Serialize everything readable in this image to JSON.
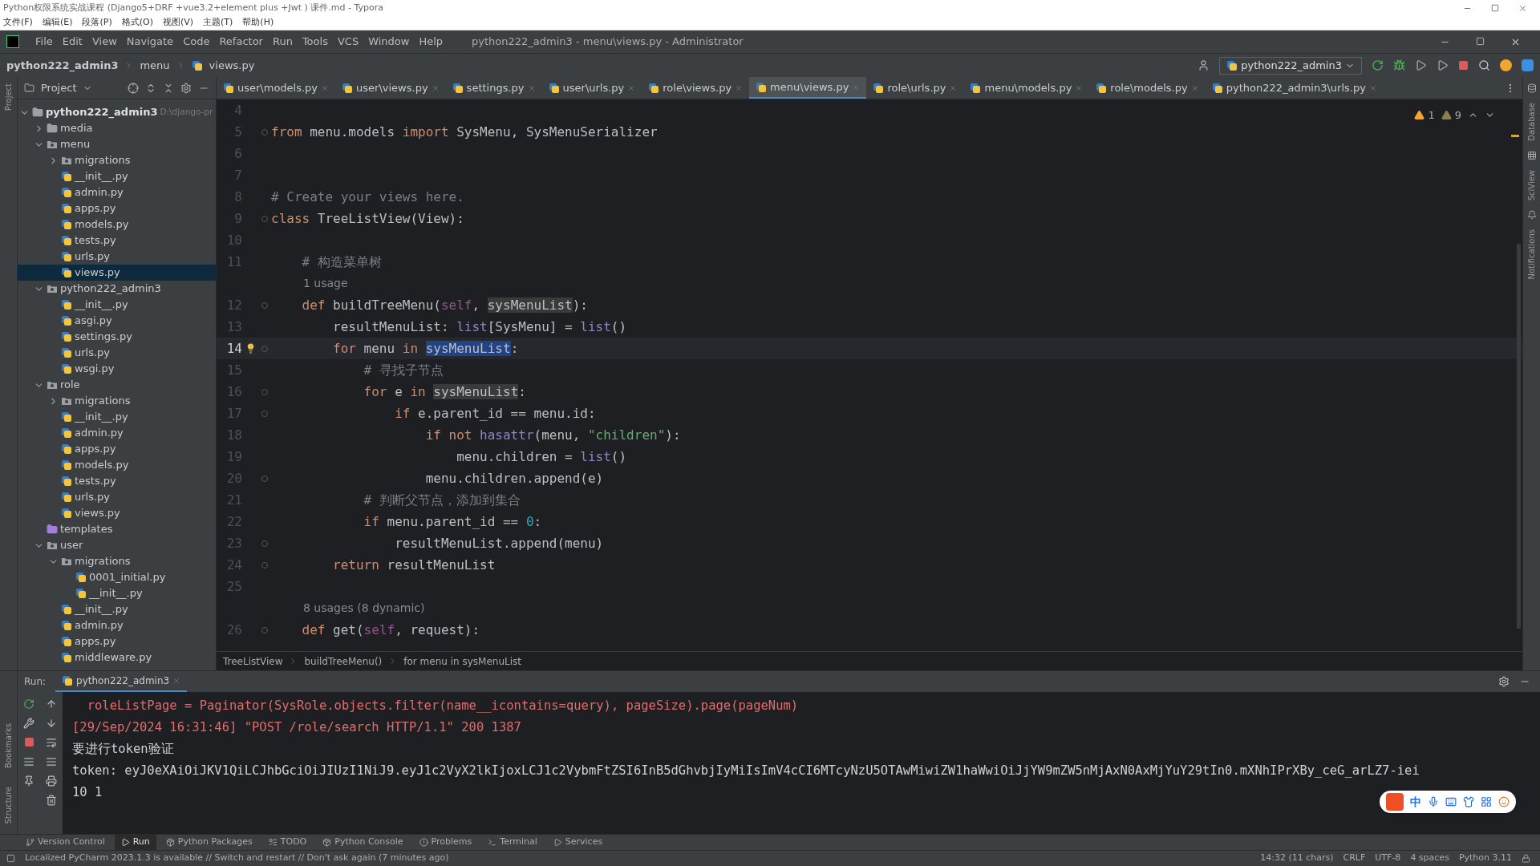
{
  "typora": {
    "title": "Python权限系统实战课程 (Django5+DRF +vue3.2+element plus +Jwt ) 课件.md - Typora",
    "menu": [
      "文件(F)",
      "编辑(E)",
      "段落(P)",
      "格式(O)",
      "视图(V)",
      "主题(T)",
      "帮助(H)"
    ]
  },
  "menu_bar": {
    "items": [
      "File",
      "Edit",
      "View",
      "Navigate",
      "Code",
      "Refactor",
      "Run",
      "Tools",
      "VCS",
      "Window",
      "Help"
    ],
    "title": "python222_admin3 - menu\\views.py - Administrator"
  },
  "nav_bar": {
    "breadcrumb": [
      "python222_admin3",
      "menu",
      "views.py"
    ],
    "run_config": "python222_admin3"
  },
  "left_strip": [
    "Project",
    "Bookmarks",
    "Structure"
  ],
  "right_strip": [
    "Database",
    "SciView",
    "Notifications"
  ],
  "project_panel": {
    "title": "Project",
    "tree": [
      {
        "name": "python222_admin3",
        "path": "D:\\django-pr",
        "kind": "folder",
        "expanded": true,
        "selected": false,
        "children": [
          {
            "name": "media",
            "kind": "folder",
            "expanded": false,
            "selected": false
          },
          {
            "name": "menu",
            "kind": "package",
            "expanded": true,
            "selected": false,
            "children": [
              {
                "name": "migrations",
                "kind": "package",
                "expanded": false,
                "selected": false
              },
              {
                "name": "__init__.py",
                "kind": "file",
                "selected": false
              },
              {
                "name": "admin.py",
                "kind": "file",
                "selected": false
              },
              {
                "name": "apps.py",
                "kind": "file",
                "selected": false
              },
              {
                "name": "models.py",
                "kind": "file",
                "selected": false
              },
              {
                "name": "tests.py",
                "kind": "file",
                "selected": false
              },
              {
                "name": "urls.py",
                "kind": "file",
                "selected": false
              },
              {
                "name": "views.py",
                "kind": "file",
                "selected": true
              }
            ]
          },
          {
            "name": "python222_admin3",
            "kind": "package",
            "expanded": true,
            "selected": false,
            "children": [
              {
                "name": "__init__.py",
                "kind": "file",
                "selected": false
              },
              {
                "name": "asgi.py",
                "kind": "file",
                "selected": false
              },
              {
                "name": "settings.py",
                "kind": "file",
                "selected": false
              },
              {
                "name": "urls.py",
                "kind": "file",
                "selected": false
              },
              {
                "name": "wsgi.py",
                "kind": "file",
                "selected": false
              }
            ]
          },
          {
            "name": "role",
            "kind": "package",
            "expanded": true,
            "selected": false,
            "children": [
              {
                "name": "migrations",
                "kind": "package",
                "expanded": false,
                "selected": false
              },
              {
                "name": "__init__.py",
                "kind": "file",
                "selected": false
              },
              {
                "name": "admin.py",
                "kind": "file",
                "selected": false
              },
              {
                "name": "apps.py",
                "kind": "file",
                "selected": false
              },
              {
                "name": "models.py",
                "kind": "file",
                "selected": false
              },
              {
                "name": "tests.py",
                "kind": "file",
                "selected": false
              },
              {
                "name": "urls.py",
                "kind": "file",
                "selected": false
              },
              {
                "name": "views.py",
                "kind": "file",
                "selected": false
              }
            ]
          },
          {
            "name": "templates",
            "kind": "templates",
            "selected": false
          },
          {
            "name": "user",
            "kind": "package",
            "expanded": true,
            "selected": false,
            "children": [
              {
                "name": "migrations",
                "kind": "package",
                "expanded": true,
                "selected": false,
                "children": [
                  {
                    "name": "0001_initial.py",
                    "kind": "file",
                    "selected": false
                  },
                  {
                    "name": "__init__.py",
                    "kind": "file",
                    "selected": false
                  }
                ]
              },
              {
                "name": "__init__.py",
                "kind": "file",
                "selected": false
              },
              {
                "name": "admin.py",
                "kind": "file",
                "selected": false
              },
              {
                "name": "apps.py",
                "kind": "file",
                "selected": false
              },
              {
                "name": "middleware.py",
                "kind": "file",
                "selected": false
              }
            ]
          }
        ]
      }
    ]
  },
  "tabs": [
    {
      "label": "user\\models.py",
      "selected": false
    },
    {
      "label": "user\\views.py",
      "selected": false
    },
    {
      "label": "settings.py",
      "selected": false
    },
    {
      "label": "user\\urls.py",
      "selected": false
    },
    {
      "label": "role\\views.py",
      "selected": false
    },
    {
      "label": "menu\\views.py",
      "selected": true
    },
    {
      "label": "role\\urls.py",
      "selected": false
    },
    {
      "label": "menu\\models.py",
      "selected": false
    },
    {
      "label": "role\\models.py",
      "selected": false
    },
    {
      "label": "python222_admin3\\urls.py",
      "selected": false
    }
  ],
  "editor": {
    "warnings": "1",
    "weak_warnings": "9",
    "lines": [
      {
        "number": "4",
        "kind": "code",
        "fold": false,
        "current": false
      },
      {
        "number": "5",
        "kind": "code",
        "fold": true,
        "current": false,
        "tokens": [
          {
            "kind": "keyword",
            "text": "from"
          },
          {
            "kind": "plain",
            "text": " menu.models "
          },
          {
            "kind": "keyword",
            "text": "import"
          },
          {
            "kind": "plain",
            "text": " SysMenu, SysMenuSerializer"
          }
        ]
      },
      {
        "number": "6",
        "kind": "code",
        "fold": false,
        "current": false
      },
      {
        "number": "7",
        "kind": "code",
        "fold": false,
        "current": false
      },
      {
        "number": "8",
        "kind": "code",
        "fold": false,
        "current": false,
        "tokens": [
          {
            "kind": "comment",
            "text": "# Create your views here."
          }
        ]
      },
      {
        "number": "9",
        "kind": "code",
        "fold": true,
        "current": false,
        "tokens": [
          {
            "kind": "keyword",
            "text": "class"
          },
          {
            "kind": "plain",
            "text": " TreeListView(View):"
          }
        ]
      },
      {
        "number": "10",
        "kind": "code",
        "fold": false,
        "current": false
      },
      {
        "number": "11",
        "kind": "code",
        "fold": false,
        "current": false,
        "tokens": [
          {
            "kind": "comment",
            "text": "    # 构造菜单树"
          }
        ]
      },
      {
        "kind": "hint",
        "text": "1 usage"
      },
      {
        "number": "12",
        "kind": "code",
        "fold": true,
        "current": false,
        "tokens": [
          {
            "kind": "keyword",
            "text": "    def"
          },
          {
            "kind": "plain",
            "text": " buildTreeMenu("
          },
          {
            "kind": "self",
            "text": "self"
          },
          {
            "kind": "plain",
            "text": ", "
          },
          {
            "kind": "usage",
            "text": "sysMenuList"
          },
          {
            "kind": "plain",
            "text": "):"
          }
        ]
      },
      {
        "number": "13",
        "kind": "code",
        "fold": false,
        "current": false,
        "tokens": [
          {
            "kind": "plain",
            "text": "        resultMenuList: "
          },
          {
            "kind": "builtin",
            "text": "list"
          },
          {
            "kind": "plain",
            "text": "[SysMenu] = "
          },
          {
            "kind": "builtin",
            "text": "list"
          },
          {
            "kind": "plain",
            "text": "()"
          }
        ]
      },
      {
        "number": "14",
        "kind": "code",
        "fold": true,
        "current": true,
        "bulb": true,
        "tokens": [
          {
            "kind": "keyword",
            "text": "        for"
          },
          {
            "kind": "plain",
            "text": " menu "
          },
          {
            "kind": "keyword",
            "text": "in "
          },
          {
            "kind": "selection",
            "text": "sysMenuList"
          },
          {
            "kind": "plain",
            "text": ":"
          }
        ]
      },
      {
        "number": "15",
        "kind": "code",
        "fold": false,
        "current": false,
        "tokens": [
          {
            "kind": "comment",
            "text": "            # 寻找子节点"
          }
        ]
      },
      {
        "number": "16",
        "kind": "code",
        "fold": true,
        "current": false,
        "tokens": [
          {
            "kind": "keyword",
            "text": "            for"
          },
          {
            "kind": "plain",
            "text": " e "
          },
          {
            "kind": "keyword",
            "text": "in "
          },
          {
            "kind": "usage",
            "text": "sysMenuList"
          },
          {
            "kind": "plain",
            "text": ":"
          }
        ]
      },
      {
        "number": "17",
        "kind": "code",
        "fold": true,
        "current": false,
        "tokens": [
          {
            "kind": "keyword",
            "text": "                if"
          },
          {
            "kind": "plain",
            "text": " e.parent_id == menu.id:"
          }
        ]
      },
      {
        "number": "18",
        "kind": "code",
        "fold": false,
        "current": false,
        "tokens": [
          {
            "kind": "keyword",
            "text": "                    if not"
          },
          {
            "kind": "builtin",
            "text": " hasattr"
          },
          {
            "kind": "plain",
            "text": "(menu, "
          },
          {
            "kind": "string",
            "text": "\"children\""
          },
          {
            "kind": "plain",
            "text": "):"
          }
        ]
      },
      {
        "number": "19",
        "kind": "code",
        "fold": false,
        "current": false,
        "tokens": [
          {
            "kind": "plain",
            "text": "                        menu.children = "
          },
          {
            "kind": "builtin",
            "text": "list"
          },
          {
            "kind": "plain",
            "text": "()"
          }
        ]
      },
      {
        "number": "20",
        "kind": "code",
        "fold": true,
        "current": false,
        "tokens": [
          {
            "kind": "plain",
            "text": "                    menu.children.append(e)"
          }
        ]
      },
      {
        "number": "21",
        "kind": "code",
        "fold": false,
        "current": false,
        "tokens": [
          {
            "kind": "comment",
            "text": "            # 判断父节点，添加到集合"
          }
        ]
      },
      {
        "number": "22",
        "kind": "code",
        "fold": false,
        "current": false,
        "tokens": [
          {
            "kind": "keyword",
            "text": "            if"
          },
          {
            "kind": "plain",
            "text": " menu.parent_id == "
          },
          {
            "kind": "number",
            "text": "0"
          },
          {
            "kind": "plain",
            "text": ":"
          }
        ]
      },
      {
        "number": "23",
        "kind": "code",
        "fold": true,
        "current": false,
        "tokens": [
          {
            "kind": "plain",
            "text": "                resultMenuList.append(menu)"
          }
        ]
      },
      {
        "number": "24",
        "kind": "code",
        "fold": true,
        "current": false,
        "tokens": [
          {
            "kind": "keyword",
            "text": "        return"
          },
          {
            "kind": "plain",
            "text": " resultMenuList"
          }
        ]
      },
      {
        "number": "25",
        "kind": "code",
        "fold": false,
        "current": false
      },
      {
        "kind": "hint",
        "text": "8 usages (8 dynamic)"
      },
      {
        "number": "26",
        "kind": "code",
        "fold": true,
        "current": false,
        "tokens": [
          {
            "kind": "keyword",
            "text": "    def"
          },
          {
            "kind": "plain",
            "text": " get("
          },
          {
            "kind": "self",
            "text": "self"
          },
          {
            "kind": "plain",
            "text": ", request):"
          }
        ]
      }
    ]
  },
  "breadcrumbs": [
    "TreeListView",
    "buildTreeMenu()",
    "for menu in sysMenuList"
  ],
  "run_panel": {
    "label": "Run:",
    "tab": "python222_admin3",
    "lines": [
      {
        "kind": "error",
        "text": "  roleListPage = Paginator(SysRole.objects.filter(name__icontains=query), pageSize).page(pageNum)"
      },
      {
        "kind": "error",
        "text": "[29/Sep/2024 16:31:46] \"POST /role/search HTTP/1.1\" 200 1387"
      },
      {
        "kind": "plain",
        "text": "要进行token验证"
      },
      {
        "kind": "plain",
        "text": "token: eyJ0eXAiOiJKV1QiLCJhbGciOiJIUzI1NiJ9.eyJ1c2VyX2lkIjoxLCJ1c2VybmFtZSI6InB5dGhvbjIyMiIsImV4cCI6MTcyNzU5OTAwMiwiZW1haWwiOiJjYW9mZW5nMjAxN0AxMjYuY29tIn0.mXNhIPrXBy_ceG_arLZ7-iei"
      },
      {
        "kind": "plain",
        "text": "10 1"
      }
    ]
  },
  "ime": {
    "label": "中"
  },
  "tool_tabs": [
    {
      "label": "Version Control",
      "selected": false
    },
    {
      "label": "Run",
      "selected": true
    },
    {
      "label": "Python Packages",
      "selected": false
    },
    {
      "label": "TODO",
      "selected": false
    },
    {
      "label": "Python Console",
      "selected": false
    },
    {
      "label": "Problems",
      "selected": false
    },
    {
      "label": "Terminal",
      "selected": false
    },
    {
      "label": "Services",
      "selected": false
    }
  ],
  "status_bar": {
    "message": "Localized PyCharm 2023.1.3 is available // Switch and restart // Don't ask again (7 minutes ago)",
    "items": [
      "14:32 (11 chars)",
      "CRLF",
      "UTF-8",
      "4 spaces",
      "Python 3.11"
    ]
  }
}
